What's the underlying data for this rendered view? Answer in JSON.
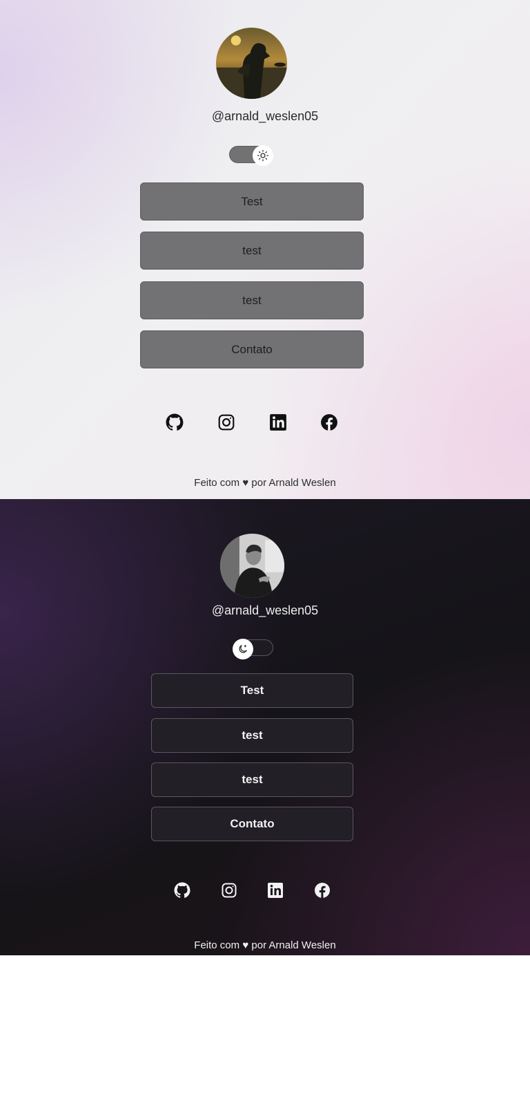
{
  "light": {
    "username": "@arnald_weslen05",
    "theme_toggle_icon": "sun-icon",
    "links": [
      {
        "label": "Test"
      },
      {
        "label": "test"
      },
      {
        "label": "test"
      },
      {
        "label": "Contato"
      }
    ],
    "socials": [
      "github-icon",
      "instagram-icon",
      "linkedin-icon",
      "facebook-icon"
    ],
    "footer": "Feito com ♥ por Arnald Weslen",
    "colors": {
      "button_bg": "#727173",
      "text": "#2a2a2a"
    }
  },
  "dark": {
    "username": "@arnald_weslen05",
    "theme_toggle_icon": "moon-icon",
    "links": [
      {
        "label": "Test"
      },
      {
        "label": "test"
      },
      {
        "label": "test"
      },
      {
        "label": "Contato"
      }
    ],
    "socials": [
      "github-icon",
      "instagram-icon",
      "linkedin-icon",
      "facebook-icon"
    ],
    "footer": "Feito com ♥ por Arnald Weslen",
    "colors": {
      "button_bg": "#221f26",
      "text": "#f2f2f2"
    }
  }
}
